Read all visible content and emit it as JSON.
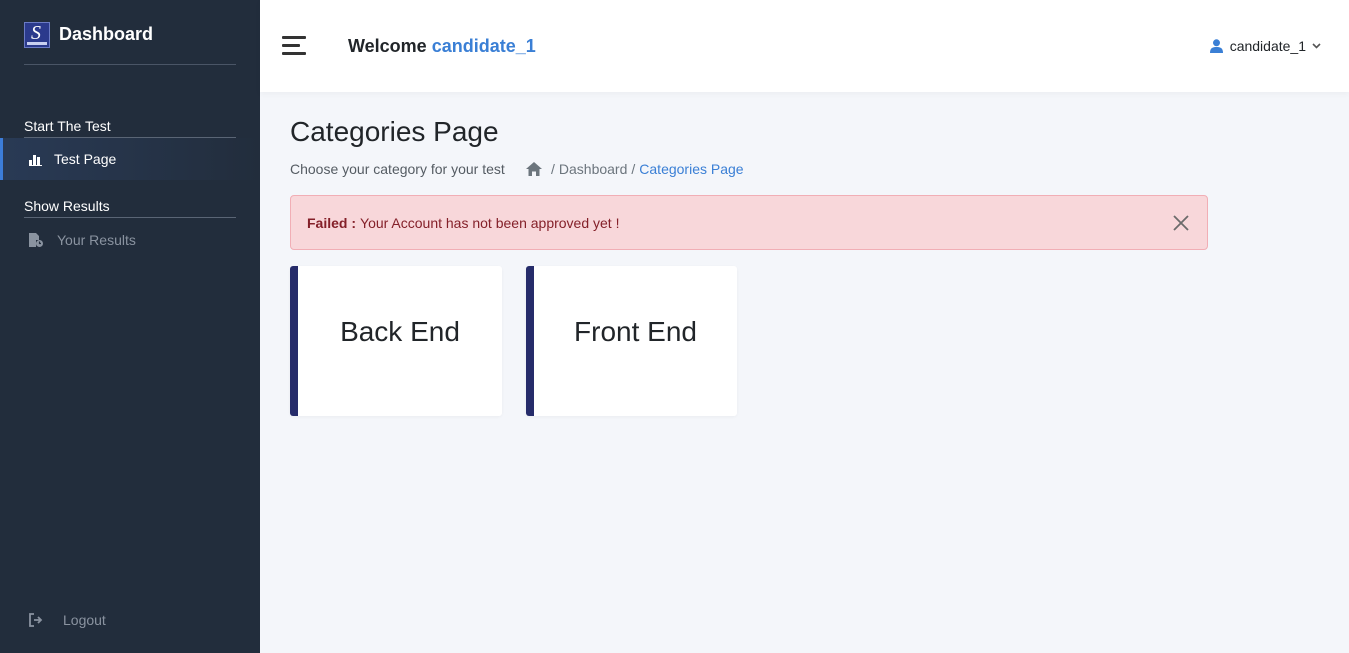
{
  "sidebar": {
    "brand_title": "Dashboard",
    "brand_logo_letter": "S",
    "sections": [
      {
        "title": "Start The Test",
        "items": [
          {
            "label": "Test Page",
            "icon": "bar-chart-icon",
            "active": true
          }
        ]
      },
      {
        "title": "Show Results",
        "items": [
          {
            "label": "Your Results",
            "icon": "file-results-icon",
            "active": false
          }
        ]
      }
    ],
    "logout_label": "Logout"
  },
  "header": {
    "welcome_prefix": "Welcome",
    "welcome_user": "candidate_1",
    "user_menu_label": "candidate_1"
  },
  "main": {
    "page_title": "Categories Page",
    "subtitle": "Choose your category for your test",
    "breadcrumb": [
      "Dashboard",
      "Categories Page"
    ],
    "alert": {
      "label": "Failed :",
      "message": "Your Account has not been approved yet !"
    },
    "categories": [
      "Back End",
      "Front End"
    ]
  },
  "colors": {
    "sidebar_bg": "#222d3c",
    "accent": "#3a7fd5",
    "card_border": "#262c6a",
    "alert_bg": "#f8d7da",
    "alert_text": "#842029"
  }
}
